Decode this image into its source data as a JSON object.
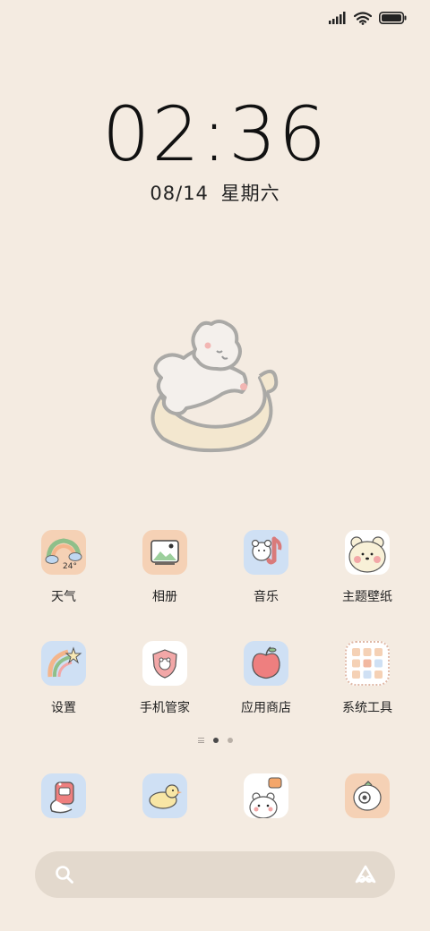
{
  "status_bar": {
    "icons": [
      "signal-icon",
      "wifi-icon",
      "battery-icon"
    ],
    "battery_level": 1.0
  },
  "clock": {
    "time": "02:36",
    "date": "08/14",
    "weekday": "星期六"
  },
  "wallpaper": {
    "icon": "sleeping-bear-on-moon"
  },
  "home_rows": [
    [
      {
        "label": "天气",
        "icon": "weather-rainbow-icon",
        "badge": "24°"
      },
      {
        "label": "相册",
        "icon": "gallery-icon"
      },
      {
        "label": "音乐",
        "icon": "music-bear-icon"
      },
      {
        "label": "主题壁纸",
        "icon": "bear-face-icon"
      }
    ],
    [
      {
        "label": "设置",
        "icon": "settings-rainbow-icon"
      },
      {
        "label": "手机管家",
        "icon": "shield-bear-icon"
      },
      {
        "label": "应用商店",
        "icon": "apple-icon"
      },
      {
        "label": "系统工具",
        "icon": "tools-folder-icon"
      }
    ]
  ],
  "page_indicator": {
    "pages": 2,
    "current": 1
  },
  "dock": [
    {
      "icon": "phone-icon"
    },
    {
      "icon": "message-chick-icon"
    },
    {
      "icon": "browser-bear-icon"
    },
    {
      "icon": "camera-icon"
    }
  ],
  "search": {
    "icons": [
      "search-icon",
      "assistant-icon"
    ]
  },
  "colors": {
    "background": "#f4ebe1",
    "search_bar": "#e3d9cd",
    "icon_orange": "#f5d1b5",
    "icon_blue": "#cfe0f4",
    "icon_white": "#ffffff"
  }
}
